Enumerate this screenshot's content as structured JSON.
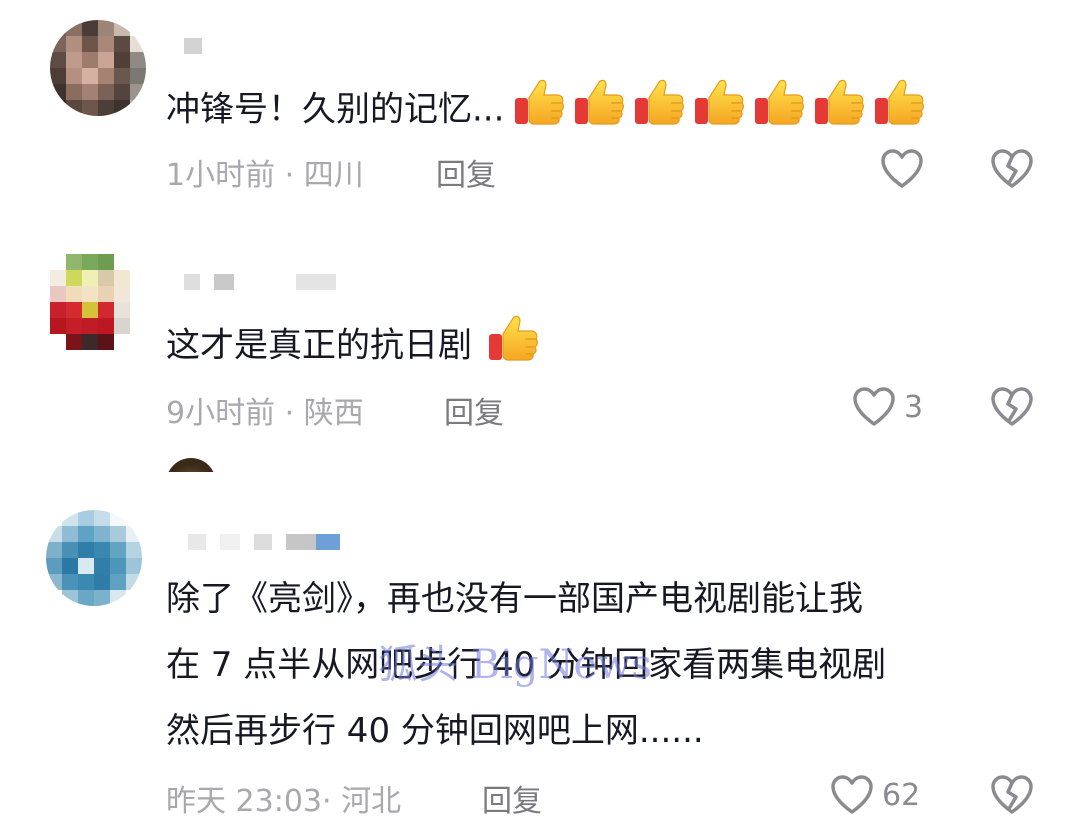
{
  "comments": [
    {
      "text": "冲锋号！久别的记忆...",
      "time": "1小时前",
      "location_sep": " · ",
      "location": "四川",
      "reply_label": "回复",
      "like_count": "",
      "thumb_emoji_count": 7
    },
    {
      "text": "这才是真正的抗日剧",
      "time": "9小时前",
      "location_sep": " · ",
      "location": "陕西",
      "reply_label": "回复",
      "like_count": "3",
      "thumb_emoji_count": 1
    },
    {
      "lines": [
        "除了《亮剑》，再也没有一部国产电视剧能让我",
        "在 7 点半从网吧步行 40 分钟回家看两集电视剧",
        "然后再步行 40 分钟回网吧上网......"
      ],
      "time": "昨天 23:03",
      "location_sep": "· ",
      "location": "河北",
      "reply_label": "回复",
      "like_count": "62"
    }
  ],
  "watermark": "狐头 BigNews",
  "colors": {
    "text": "#161823",
    "meta": "#a8a8ad",
    "reply": "#7a7a80",
    "icon": "#8a8a90"
  },
  "icons": [
    "thumbs-up-emoji",
    "heart-outline-icon",
    "broken-heart-icon"
  ]
}
